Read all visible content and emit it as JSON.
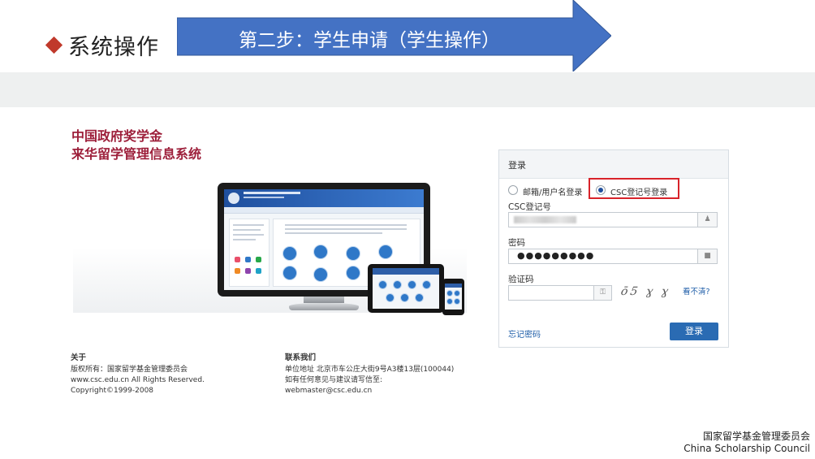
{
  "slide": {
    "section_title": "系统操作",
    "step_banner": "第二步：学生申请（学生操作）"
  },
  "system": {
    "title_line1": "中国政府奖学金",
    "title_line2": "来华留学管理信息系统"
  },
  "login": {
    "title": "登录",
    "radio_email": "邮箱/用户名登录",
    "radio_csc": "CSC登记号登录",
    "selected": "CSC登记号登录",
    "csc_label": "CSC登记号",
    "password_label": "密码",
    "password_value": "●●●●●●●●●",
    "captcha_label": "验证码",
    "captcha_image_text": "ō5 ɣ ɣ",
    "captcha_refresh": "看不清?",
    "forgot_password": "忘记密码",
    "login_button": "登录",
    "accent_color": "#2a6bb3",
    "highlight_color": "#d8232a"
  },
  "footer": {
    "about_heading": "关于",
    "about_line1": "版权所有：国家留学基金管理委员会",
    "about_line2": "www.csc.edu.cn All Rights Reserved.",
    "about_line3": "Copyright©1999-2008",
    "contact_heading": "联系我们",
    "contact_line1": "单位地址 北京市车公庄大街9号A3楼13层(100044)",
    "contact_line2": "如有任何意见与建议请写信至:",
    "contact_line3": "webmaster@csc.edu.cn"
  },
  "organization": {
    "name_cn": "国家留学基金管理委员会",
    "name_en": "China Scholarship Council"
  }
}
